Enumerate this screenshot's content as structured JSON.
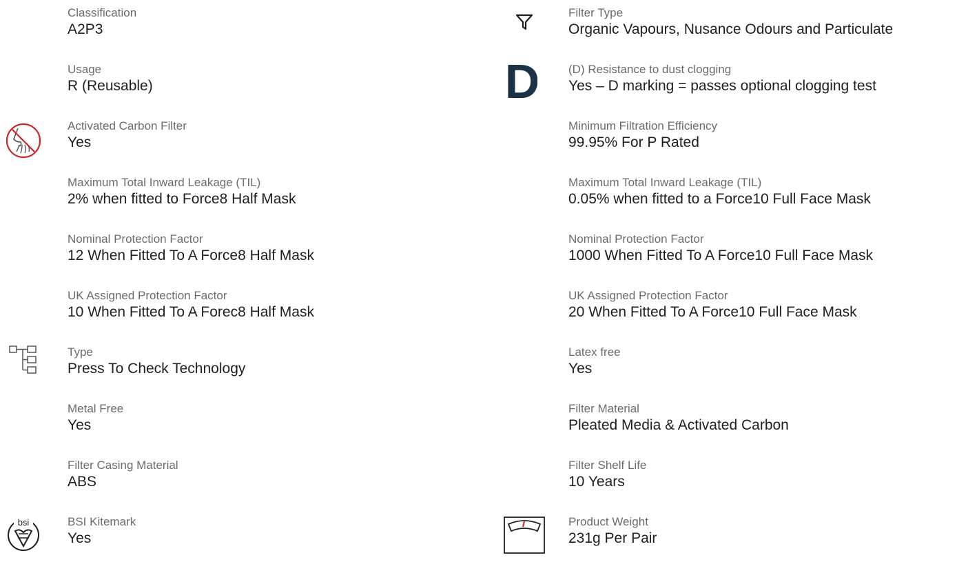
{
  "left": [
    {
      "label": "Classification",
      "value": "A2P3",
      "icon": ""
    },
    {
      "label": "Usage",
      "value": "R (Reusable)",
      "icon": ""
    },
    {
      "label": "Activated Carbon Filter",
      "value": "Yes",
      "icon": "no-odour-icon"
    },
    {
      "label": "Maximum Total Inward Leakage (TIL)",
      "value": "2% when fitted to Force8 Half Mask",
      "icon": ""
    },
    {
      "label": "Nominal Protection Factor",
      "value": "12 When Fitted To A Force8 Half Mask",
      "icon": ""
    },
    {
      "label": "UK Assigned Protection Factor",
      "value": "10 When Fitted To A Forec8 Half Mask",
      "icon": ""
    },
    {
      "label": "Type",
      "value": "Press To Check Technology",
      "icon": "hierarchy-icon"
    },
    {
      "label": "Metal Free",
      "value": "Yes",
      "icon": ""
    },
    {
      "label": "Filter Casing Material",
      "value": "ABS",
      "icon": ""
    },
    {
      "label": "BSI Kitemark",
      "value": "Yes",
      "icon": "bsi-kitemark-icon",
      "icon_text": "bsi"
    }
  ],
  "right": [
    {
      "label": "Filter Type",
      "value": "Organic Vapours, Nusance Odours and Particulate",
      "icon": "funnel-icon"
    },
    {
      "label": "(D) Resistance to dust clogging",
      "value": "Yes – D marking = passes optional clogging test",
      "icon": "d-marking-icon",
      "icon_text": "D"
    },
    {
      "label": "Minimum Filtration Efficiency",
      "value": "99.95% For P Rated",
      "icon": ""
    },
    {
      "label": "Maximum Total Inward Leakage (TIL)",
      "value": "0.05% when fitted to a Force10 Full Face Mask",
      "icon": ""
    },
    {
      "label": "Nominal Protection Factor",
      "value": "1000 When Fitted To A Force10 Full Face Mask",
      "icon": ""
    },
    {
      "label": "UK Assigned Protection Factor",
      "value": "20 When Fitted To A Force10 Full Face Mask",
      "icon": ""
    },
    {
      "label": "Latex free",
      "value": "Yes",
      "icon": ""
    },
    {
      "label": "Filter Material",
      "value": "Pleated Media & Activated Carbon",
      "icon": ""
    },
    {
      "label": "Filter Shelf Life",
      "value": "10 Years",
      "icon": ""
    },
    {
      "label": "Product Weight",
      "value": "231g Per Pair",
      "icon": "weighing-scale-icon"
    }
  ],
  "colors": {
    "text": "#1f1f1f",
    "label": "#6b6b6b",
    "accent_red": "#d0242b",
    "d_navy": "#1c3347",
    "icon_grey": "#555555"
  }
}
